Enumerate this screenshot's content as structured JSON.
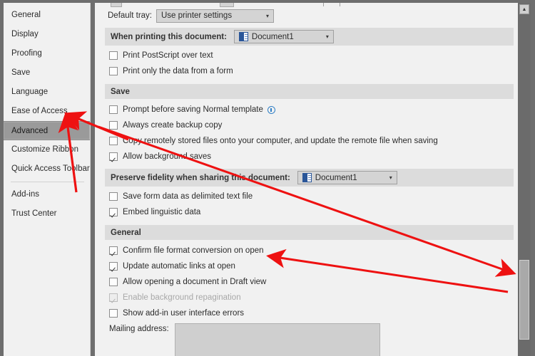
{
  "sidebar": {
    "items": [
      {
        "label": "General",
        "selected": false
      },
      {
        "label": "Display",
        "selected": false
      },
      {
        "label": "Proofing",
        "selected": false
      },
      {
        "label": "Save",
        "selected": false
      },
      {
        "label": "Language",
        "selected": false
      },
      {
        "label": "Ease of Access",
        "selected": false
      },
      {
        "label": "Advanced",
        "selected": true
      },
      {
        "label": "Customize Ribbon",
        "selected": false
      },
      {
        "label": "Quick Access Toolbar",
        "selected": false
      },
      {
        "label": "Add-ins",
        "selected": false
      },
      {
        "label": "Trust Center",
        "selected": false
      }
    ]
  },
  "print": {
    "default_tray_label": "Default tray:",
    "default_tray_value": "Use printer settings",
    "when_printing_label": "When printing this document:",
    "when_printing_value": "Document1",
    "options": [
      {
        "label": "Print PostScript over text",
        "checked": false,
        "disabled": false
      },
      {
        "label": "Print only the data from a form",
        "checked": false,
        "disabled": false
      }
    ]
  },
  "save_section": {
    "title": "Save",
    "options": [
      {
        "label": "Prompt before saving Normal template",
        "checked": false,
        "disabled": false,
        "info": true
      },
      {
        "label": "Always create backup copy",
        "checked": false,
        "disabled": false,
        "info": false
      },
      {
        "label": "Copy remotely stored files onto your computer, and update the remote file when saving",
        "checked": false,
        "disabled": false,
        "info": false
      },
      {
        "label": "Allow background saves",
        "checked": true,
        "disabled": false,
        "info": false
      }
    ]
  },
  "fidelity_section": {
    "title": "Preserve fidelity when sharing this document:",
    "document_value": "Document1",
    "options": [
      {
        "label": "Save form data as delimited text file",
        "checked": false,
        "disabled": false
      },
      {
        "label": "Embed linguistic data",
        "checked": true,
        "disabled": false
      }
    ]
  },
  "general_section": {
    "title": "General",
    "options": [
      {
        "label": "Confirm file format conversion on open",
        "checked": true,
        "disabled": false
      },
      {
        "label": "Update automatic links at open",
        "checked": true,
        "disabled": false
      },
      {
        "label": "Allow opening a document in Draft view",
        "checked": false,
        "disabled": false
      },
      {
        "label": "Enable background repagination",
        "checked": true,
        "disabled": true
      },
      {
        "label": "Show add-in user interface errors",
        "checked": false,
        "disabled": false
      }
    ],
    "mailing_address_label": "Mailing address:",
    "mailing_address_value": ""
  },
  "scrollbar": {
    "up_arrow": "▲"
  },
  "icons": {
    "caret_down": "▾",
    "document_icon": "word-document-icon",
    "info_icon": "info-circle-icon"
  },
  "annotations": {
    "color": "#ee1111",
    "count": 4
  }
}
